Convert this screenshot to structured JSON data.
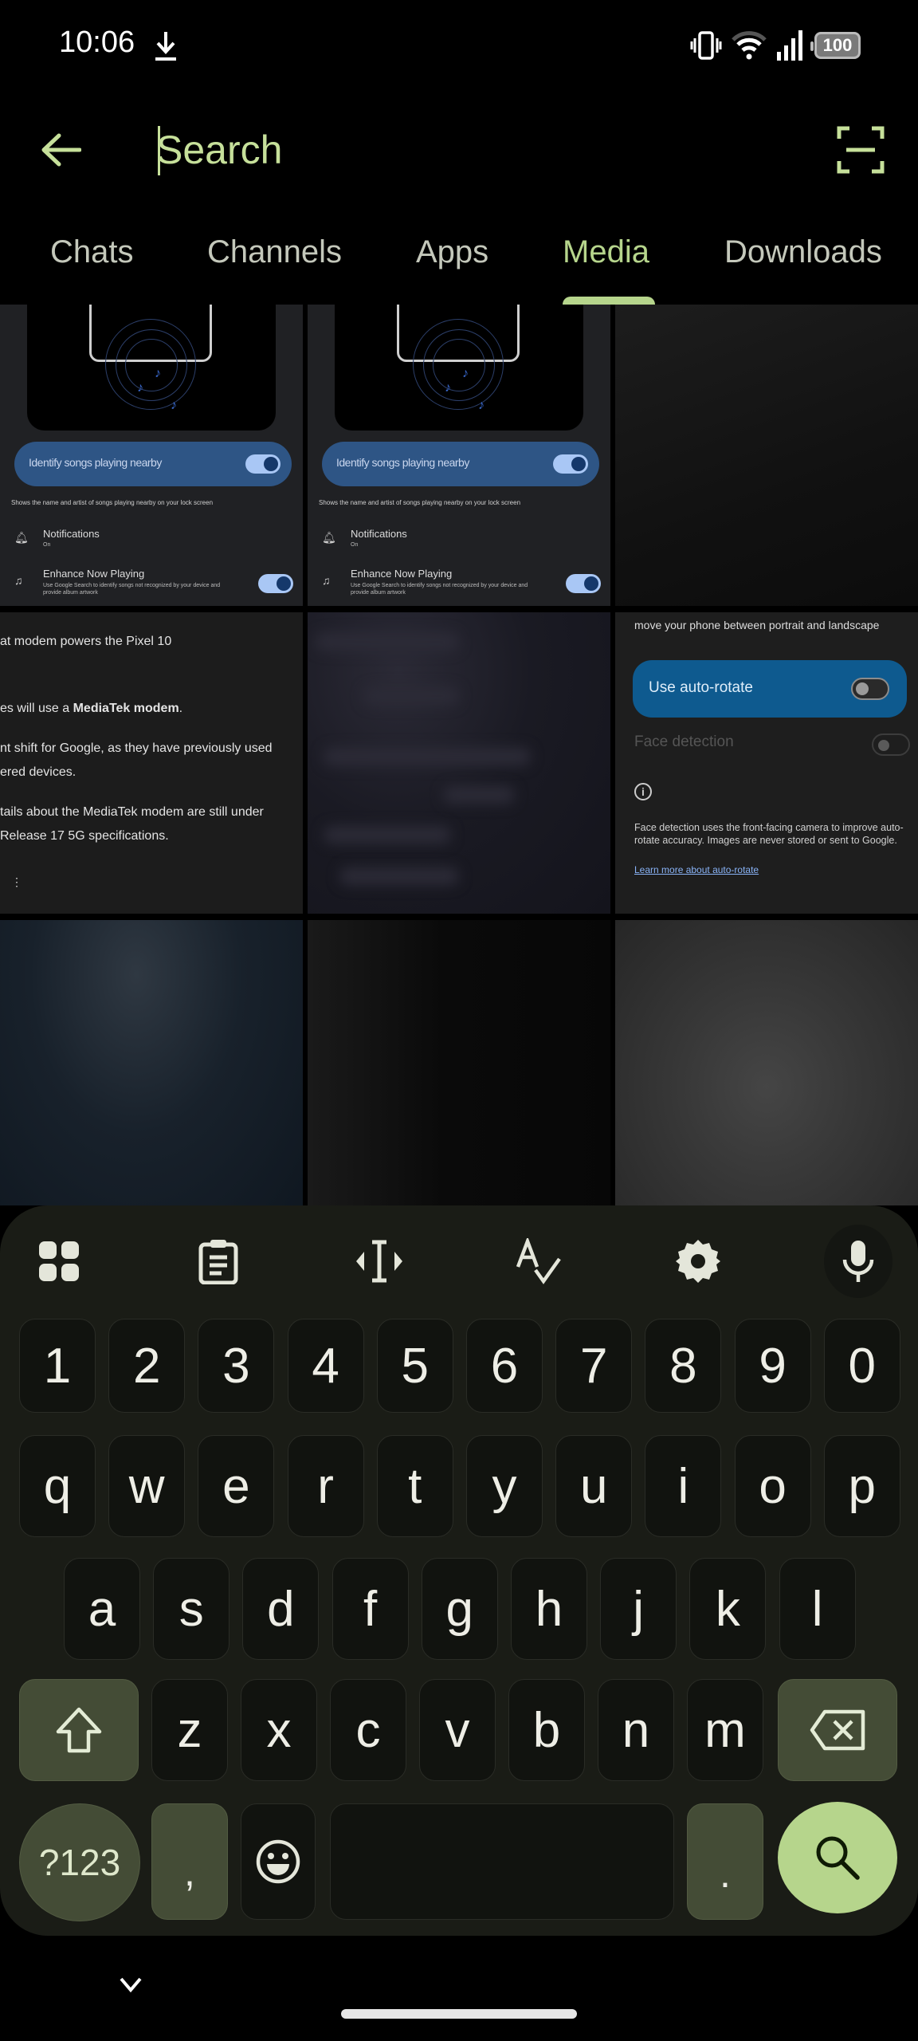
{
  "status_bar": {
    "time": "10:06",
    "icons": [
      "download-icon",
      "vibrate-icon",
      "wifi-icon",
      "signal-icon",
      "battery-icon"
    ],
    "battery_level": "100"
  },
  "search": {
    "placeholder": "Search",
    "value": "",
    "back_icon": "arrow-left-icon",
    "scan_icon": "scan-icon"
  },
  "tabs": [
    {
      "label": "Chats",
      "active": false
    },
    {
      "label": "Channels",
      "active": false
    },
    {
      "label": "Apps",
      "active": false
    },
    {
      "label": "Media",
      "active": true
    },
    {
      "label": "Downloads",
      "active": false
    }
  ],
  "colors": {
    "accent": "#b6d58c",
    "background": "#000000",
    "keyboard_bg": "#1a1c16",
    "key_bg": "#11130f",
    "modifier_key_bg": "#444c36"
  },
  "media": {
    "now_playing": {
      "toggle_label": "Identify songs playing nearby",
      "description": "Shows the name and artist of songs playing nearby on your lock screen",
      "notifications_title": "Notifications",
      "notifications_sub": "On",
      "enhance_title": "Enhance Now Playing",
      "enhance_sub": "Use Google Search to identify songs not recognized by your device and provide album artwork"
    },
    "article": {
      "line1": "at modem powers the Pixel 10",
      "line2_pre": "es will use a ",
      "line2_bold": "MediaTek modem",
      "line2_post": ".",
      "line3": "nt shift for Google, as they have previously used",
      "line4": "ered devices.",
      "line5": "tails about the MediaTek modem are still under",
      "line6": " Release 17 5G specifications.",
      "more": "⋮"
    },
    "auto_rotate": {
      "top_text": "move your phone between portrait and landscape",
      "toggle_label": "Use auto-rotate",
      "face_detection": "Face detection",
      "info_icon": "i",
      "description": "Face detection uses the front-facing camera to improve auto-rotate accuracy. Images are never stored or sent to Google.",
      "link": "Learn more about auto-rotate"
    }
  },
  "keyboard": {
    "toolbar": [
      "apps-grid-icon",
      "clipboard-icon",
      "text-cursor-icon",
      "spellcheck-icon",
      "settings-gear-icon",
      "microphone-icon"
    ],
    "number_row": [
      "1",
      "2",
      "3",
      "4",
      "5",
      "6",
      "7",
      "8",
      "9",
      "0"
    ],
    "row1": [
      "q",
      "w",
      "e",
      "r",
      "t",
      "y",
      "u",
      "i",
      "o",
      "p"
    ],
    "row2": [
      "a",
      "s",
      "d",
      "f",
      "g",
      "h",
      "j",
      "k",
      "l"
    ],
    "row3": [
      "z",
      "x",
      "c",
      "v",
      "b",
      "n",
      "m"
    ],
    "symbols_label": "?123",
    "comma": ",",
    "period": ".",
    "space_label": ""
  },
  "nav": {
    "hide_keyboard_icon": "chevron-down-icon"
  }
}
